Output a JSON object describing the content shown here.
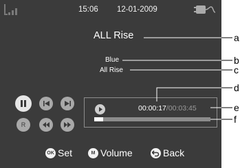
{
  "status_bar": {
    "time": "15:06",
    "date": "12-01-2009"
  },
  "track": {
    "title": "ALL Rise",
    "artist": "Blue",
    "album": "All Rise"
  },
  "playback": {
    "elapsed": "00:00:17",
    "separator": "/",
    "total": "00:03:45",
    "progress": 0.075
  },
  "controls": {
    "pause_icon": "pause-icon",
    "prev_icon": "skip-previous-icon",
    "next_icon": "skip-next-icon",
    "repeat_label": "R",
    "rewind_icon": "rewind-icon",
    "forward_icon": "fast-forward-icon"
  },
  "softkeys": {
    "set": {
      "badge": "OK",
      "label": "Set"
    },
    "volume": {
      "badge": "M",
      "label": "Volume"
    },
    "back": {
      "icon": "back-arrow-icon",
      "label": "Back"
    }
  },
  "callouts": [
    "a",
    "b",
    "c",
    "d",
    "e",
    "f"
  ],
  "colors": {
    "screen": "#3b3b3b",
    "text": "#ffffff",
    "muted": "#9a9a9a",
    "progress_track": "#8c8c8c"
  }
}
